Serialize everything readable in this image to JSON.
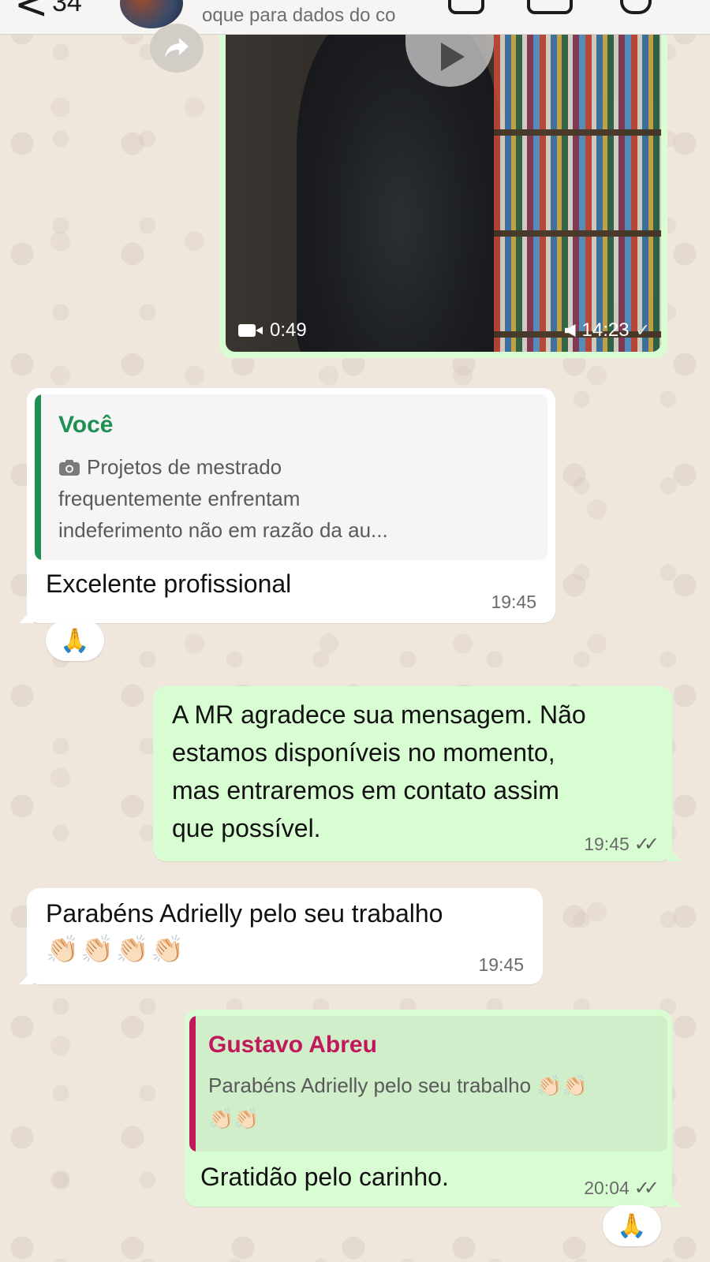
{
  "header": {
    "back_label": "<",
    "unread_count": "34",
    "subtitle": "oque para dados do co"
  },
  "video_message": {
    "duration": "0:49",
    "time": "14:23",
    "status": "sent"
  },
  "messages": [
    {
      "direction": "incoming",
      "quote": {
        "author": "Você",
        "author_color": "#1f8f54",
        "photo_icon": "camera-icon",
        "lines": [
          "Projetos de mestrado",
          "frequentemente enfrentam",
          "indeferimento não em razão da au..."
        ]
      },
      "text": "Excelente profissional",
      "time": "19:45",
      "reaction": "🙏"
    },
    {
      "direction": "outgoing",
      "lines": [
        "A MR agradece sua mensagem. Não",
        "estamos disponíveis no momento,",
        "mas entraremos em contato assim",
        "que possível."
      ],
      "time": "19:45",
      "status": "read"
    },
    {
      "direction": "incoming",
      "text": "Parabéns Adrielly pelo seu trabalho",
      "emoji_line": "👏🏻👏🏻👏🏻👏🏻",
      "time": "19:45"
    },
    {
      "direction": "outgoing",
      "quote": {
        "author": "Gustavo Abreu",
        "author_color": "#c2185b",
        "line1": "Parabéns Adrielly pelo seu trabalho 👏🏻👏🏻",
        "line2": "👏🏻👏🏻"
      },
      "text": "Gratidão pelo carinho.",
      "time": "20:04",
      "status": "read",
      "reaction": "🙏"
    }
  ],
  "colors": {
    "outgoing_bubble": "#d9fdd3",
    "incoming_bubble": "#ffffff",
    "wallpaper": "#efe6dc"
  }
}
